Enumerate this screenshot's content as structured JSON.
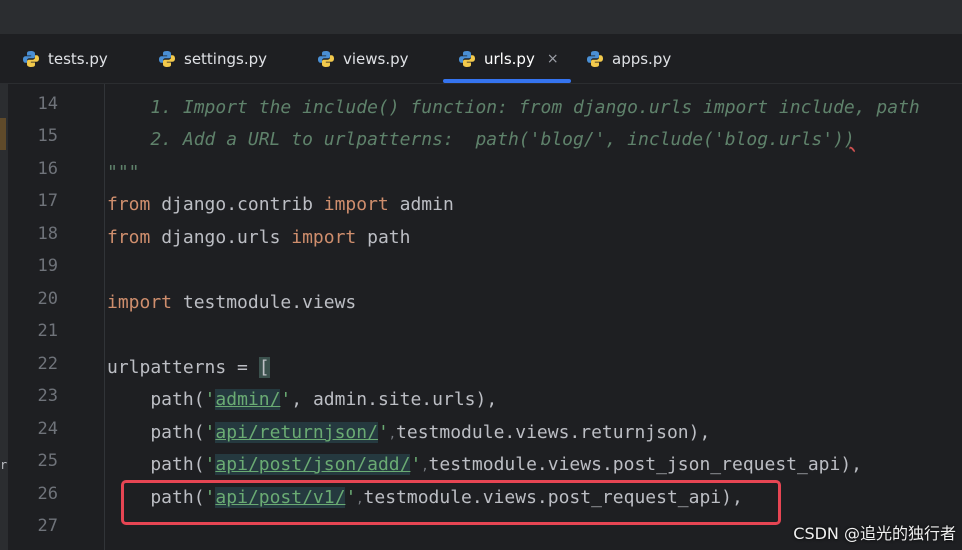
{
  "tabs": [
    {
      "label": "tests.py",
      "active": false
    },
    {
      "label": "settings.py",
      "active": false
    },
    {
      "label": "views.py",
      "active": false
    },
    {
      "label": "urls.py",
      "active": true,
      "close": "×"
    },
    {
      "label": "apps.py",
      "active": false
    }
  ],
  "line_numbers": [
    "14",
    "15",
    "16",
    "17",
    "18",
    "19",
    "20",
    "21",
    "22",
    "23",
    "24",
    "25",
    "26",
    "27"
  ],
  "code": {
    "l14": "    1. Import the include() function: from django.urls import include, path",
    "l15_a": "    2. Add a URL to urlpatterns:  path('blog/', include('blog.urls')",
    "l15_b": ")",
    "l16": "\"\"\"",
    "l17": {
      "kw1": "from",
      "mod": " django.contrib ",
      "kw2": "import",
      "name": " admin"
    },
    "l18": {
      "kw1": "from",
      "mod": " django.urls ",
      "kw2": "import",
      "name": " path"
    },
    "l20": {
      "kw": "import",
      "rest": " testmodule.views"
    },
    "l22": {
      "a": "urlpatterns = ",
      "b": "["
    },
    "l23": {
      "pre": "    path(",
      "q1": "'",
      "s": "admin/",
      "q2": "'",
      "post": ", admin.site.urls),"
    },
    "l24": {
      "pre": "    path(",
      "q1": "'",
      "s": "api/returnjson/",
      "q2": "'",
      "hint": ",",
      "post": "testmodule.views.returnjson),"
    },
    "l25": {
      "pre": "    path(",
      "q1": "'",
      "s": "api/post/json/add/",
      "q2": "'",
      "hint": ",",
      "post": "testmodule.views.post_json_request_api),"
    },
    "l26": {
      "pre": "    path(",
      "q1": "'",
      "s": "api/post/v1/",
      "q2": "'",
      "hint": ",",
      "post": "testmodule.views.post_request_api),"
    }
  },
  "watermark": "CSDN @追光的独行者",
  "colors": {
    "accent": "#3574f0",
    "highlight_box": "#e64553",
    "keyword": "#cf8e6d",
    "string": "#6aab73",
    "comment": "#5f826b"
  },
  "icons": {
    "tab": "python-icon"
  }
}
